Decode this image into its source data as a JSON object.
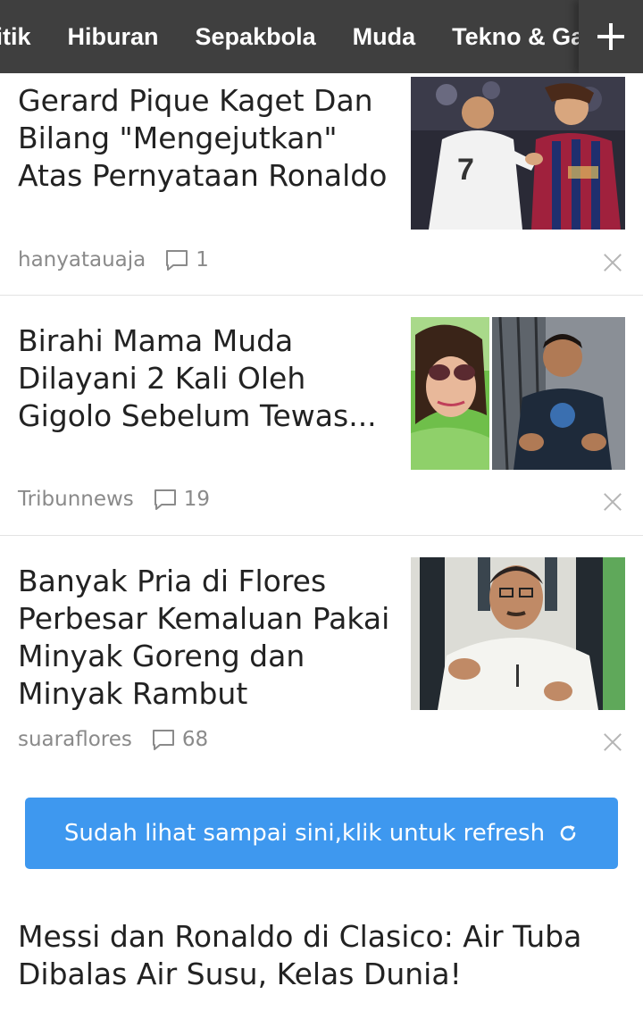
{
  "nav": {
    "tabs": [
      "litik",
      "Hiburan",
      "Sepakbola",
      "Muda",
      "Tekno & Ga"
    ],
    "add_icon": "plus-icon"
  },
  "articles": [
    {
      "title": "Gerard Pique Kaget Dan Bilang \"Mengejutkan\" Atas Pernyataan Ronaldo",
      "source": "hanyatauaja",
      "comments": "1",
      "image": "two football players shaking hands"
    },
    {
      "title": "Birahi Mama Muda Dilayani 2 Kali Oleh Gigolo Sebelum Tewas...",
      "source": "Tribunnews",
      "comments": "19",
      "image": "woman with sunglasses and a man"
    },
    {
      "title": "Banyak Pria di Flores Perbesar Kemaluan Pakai Minyak Goreng dan Minyak Rambut",
      "source": "suaraflores",
      "comments": "68",
      "image": "man in white shirt speaking"
    }
  ],
  "refresh": {
    "label": "Sudah lihat sampai sini,klik untuk refresh",
    "icon": "refresh-icon"
  },
  "next_article": {
    "title": "Messi dan Ronaldo di Clasico: Air Tuba Dibalas Air Susu, Kelas Dunia!"
  },
  "colors": {
    "topbar": "#3f3f3f",
    "accent": "#3e98ef",
    "meta_text": "#8a8a8a"
  }
}
